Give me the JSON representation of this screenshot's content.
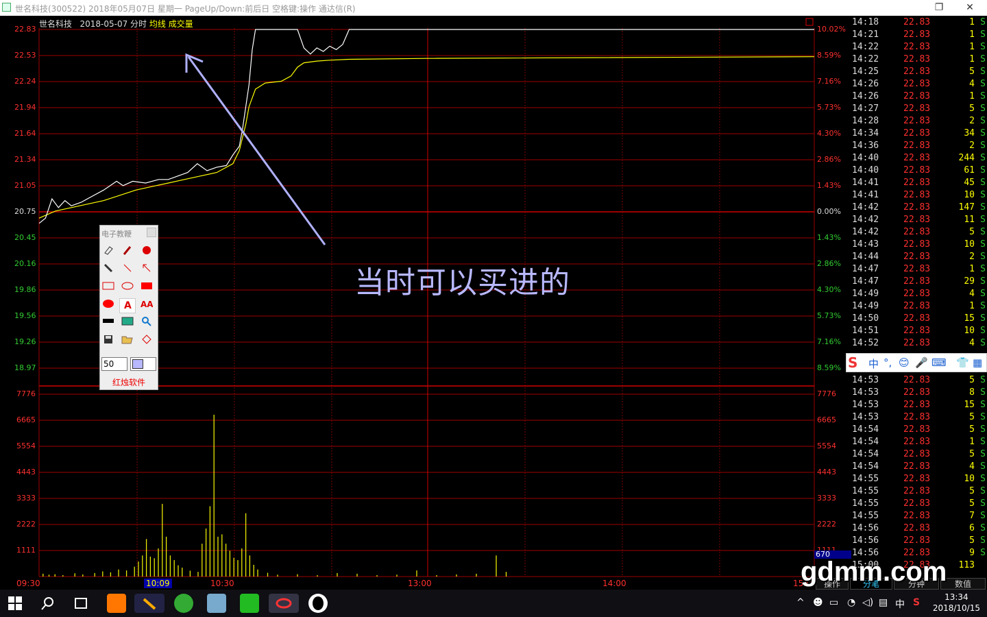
{
  "window": {
    "title": "世名科技(300522) 2018年05月07日 星期一 PageUp/Down:前后日 空格键:操作 通达信(R)",
    "restore_glyph": "❐",
    "close_glyph": "✕"
  },
  "chart": {
    "stock_name": "世名科技",
    "date_label": "2018-05-07 分时",
    "avg_label": "均线",
    "volume_label": "成交量",
    "price_ticks": [
      "22.83",
      "22.53",
      "22.24",
      "21.94",
      "21.64",
      "21.34",
      "21.05",
      "20.75",
      "20.45",
      "20.16",
      "19.86",
      "19.56",
      "19.26",
      "18.97"
    ],
    "pct_ticks": [
      "10.02%",
      "8.59%",
      "7.16%",
      "5.73%",
      "4.30%",
      "2.86%",
      "1.43%",
      "0.00%",
      "1.43%",
      "2.86%",
      "4.30%",
      "5.73%",
      "7.16%",
      "8.59%"
    ],
    "volume_ticks": [
      "7776",
      "6665",
      "5554",
      "4443",
      "3333",
      "2222",
      "1111"
    ],
    "current_volume": "670",
    "time_labels": [
      "09:30",
      "10:09",
      "10:30",
      "13:00",
      "14:00",
      "15:00"
    ],
    "annotation_text": "当时可以买进的",
    "colors": {
      "price_line": "#ffffff",
      "avg_line": "#ffff00",
      "grid": "#b00000",
      "up": "#ff3030",
      "down": "#33cc33"
    }
  },
  "ticks": [
    {
      "time": "14:18",
      "price": "22.83",
      "vol": "1",
      "side": "S"
    },
    {
      "time": "14:21",
      "price": "22.83",
      "vol": "1",
      "side": "S"
    },
    {
      "time": "14:22",
      "price": "22.83",
      "vol": "1",
      "side": "S"
    },
    {
      "time": "14:22",
      "price": "22.83",
      "vol": "1",
      "side": "S"
    },
    {
      "time": "14:25",
      "price": "22.83",
      "vol": "5",
      "side": "S"
    },
    {
      "time": "14:26",
      "price": "22.83",
      "vol": "4",
      "side": "S"
    },
    {
      "time": "14:26",
      "price": "22.83",
      "vol": "1",
      "side": "S"
    },
    {
      "time": "14:27",
      "price": "22.83",
      "vol": "5",
      "side": "S"
    },
    {
      "time": "14:28",
      "price": "22.83",
      "vol": "2",
      "side": "S"
    },
    {
      "time": "14:34",
      "price": "22.83",
      "vol": "34",
      "side": "S"
    },
    {
      "time": "14:36",
      "price": "22.83",
      "vol": "2",
      "side": "S"
    },
    {
      "time": "14:40",
      "price": "22.83",
      "vol": "244",
      "side": "S"
    },
    {
      "time": "14:40",
      "price": "22.83",
      "vol": "61",
      "side": "S"
    },
    {
      "time": "14:41",
      "price": "22.83",
      "vol": "45",
      "side": "S"
    },
    {
      "time": "14:41",
      "price": "22.83",
      "vol": "10",
      "side": "S"
    },
    {
      "time": "14:42",
      "price": "22.83",
      "vol": "147",
      "side": "S"
    },
    {
      "time": "14:42",
      "price": "22.83",
      "vol": "11",
      "side": "S"
    },
    {
      "time": "14:42",
      "price": "22.83",
      "vol": "5",
      "side": "S"
    },
    {
      "time": "14:43",
      "price": "22.83",
      "vol": "10",
      "side": "S"
    },
    {
      "time": "14:44",
      "price": "22.83",
      "vol": "2",
      "side": "S"
    },
    {
      "time": "14:47",
      "price": "22.83",
      "vol": "1",
      "side": "S"
    },
    {
      "time": "14:47",
      "price": "22.83",
      "vol": "29",
      "side": "S"
    },
    {
      "time": "14:49",
      "price": "22.83",
      "vol": "4",
      "side": "S"
    },
    {
      "time": "14:49",
      "price": "22.83",
      "vol": "1",
      "side": "S"
    },
    {
      "time": "14:50",
      "price": "22.83",
      "vol": "15",
      "side": "S"
    },
    {
      "time": "14:51",
      "price": "22.83",
      "vol": "10",
      "side": "S"
    },
    {
      "time": "14:52",
      "price": "22.83",
      "vol": "4",
      "side": "S"
    },
    {
      "time": "14:53",
      "price": "22.83",
      "vol": "5",
      "side": "S"
    },
    {
      "time": "14:53",
      "price": "22.83",
      "vol": "8",
      "side": "S"
    },
    {
      "time": "14:53",
      "price": "22.83",
      "vol": "15",
      "side": "S"
    },
    {
      "time": "14:53",
      "price": "22.83",
      "vol": "5",
      "side": "S"
    },
    {
      "time": "14:54",
      "price": "22.83",
      "vol": "5",
      "side": "S"
    },
    {
      "time": "14:54",
      "price": "22.83",
      "vol": "1",
      "side": "S"
    },
    {
      "time": "14:54",
      "price": "22.83",
      "vol": "5",
      "side": "S"
    },
    {
      "time": "14:54",
      "price": "22.83",
      "vol": "4",
      "side": "S"
    },
    {
      "time": "14:55",
      "price": "22.83",
      "vol": "10",
      "side": "S"
    },
    {
      "time": "14:55",
      "price": "22.83",
      "vol": "5",
      "side": "S"
    },
    {
      "time": "14:55",
      "price": "22.83",
      "vol": "5",
      "side": "S"
    },
    {
      "time": "14:55",
      "price": "22.83",
      "vol": "7",
      "side": "S"
    },
    {
      "time": "14:56",
      "price": "22.83",
      "vol": "6",
      "side": "S"
    },
    {
      "time": "14:56",
      "price": "22.83",
      "vol": "5",
      "side": "S"
    },
    {
      "time": "14:56",
      "price": "22.83",
      "vol": "9",
      "side": "S"
    },
    {
      "time": "15:00",
      "price": "22.83",
      "vol": "113",
      "side": ""
    }
  ],
  "tabs": [
    "操作",
    "分笔",
    "分钟",
    "数值"
  ],
  "ime_bar": {
    "logo": "S",
    "mode": "中",
    "punct": "°,",
    "icons": [
      "😊",
      "🎤",
      "⌨",
      "👕",
      "▦"
    ]
  },
  "toolbox": {
    "title": "电子教鞭",
    "size_value": "50",
    "brand": "红烛软件",
    "tools": [
      "eraser-icon",
      "pen-icon",
      "highlighter-icon",
      "marker-icon",
      "line-icon",
      "arrow-icon",
      "rectangle-icon",
      "ellipse-icon",
      "filled-rectangle-icon",
      "filled-ellipse-icon",
      "text-icon",
      "font-size-icon",
      "black-bar-icon",
      "screen-icon",
      "zoom-icon",
      "save-icon",
      "open-icon",
      "diamond-icon"
    ]
  },
  "taskbar": {
    "time": "13:34",
    "date": "2018/10/15",
    "ime_mode": "中",
    "apps": [
      "start-icon",
      "search-icon",
      "task-view-icon",
      "app-orange-icon",
      "app-torch-icon",
      "app-green-icon",
      "app-notes-icon",
      "wechat-icon",
      "app-tdx-icon",
      "qq-icon"
    ]
  },
  "watermark": "gdmm.com"
}
